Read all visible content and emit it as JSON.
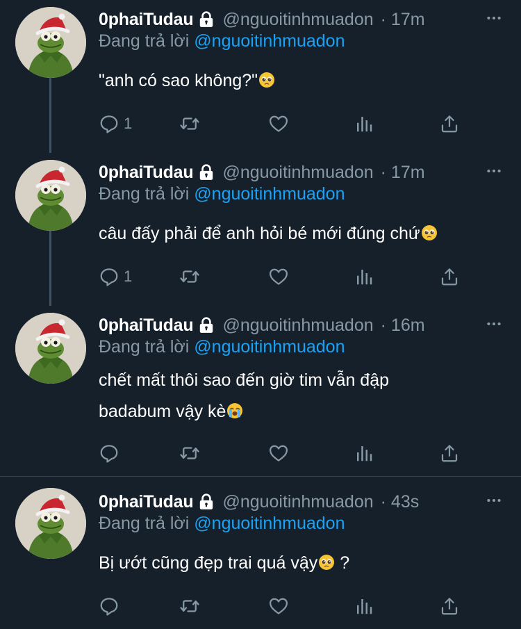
{
  "colors": {
    "background": "#15202b",
    "text": "#ffffff",
    "secondary": "#8899a6",
    "accent": "#1da1f2",
    "divider": "#38444d"
  },
  "tweets": [
    {
      "name": "0phaiTudau",
      "handle": "@nguoitinhmuadon",
      "time": "· 17m",
      "reply_prefix": "Đang trả lời ",
      "reply_to": "@nguoitinhmuadon",
      "lines": [
        "\"anh có sao không?\""
      ],
      "emoji": "pleading-face",
      "trailing_text": "",
      "reply_count": "1",
      "icons": [
        "comment-icon",
        "retweet-icon",
        "like-icon",
        "analytics-icon",
        "share-icon"
      ]
    },
    {
      "name": "0phaiTudau",
      "handle": "@nguoitinhmuadon",
      "time": "· 17m",
      "reply_prefix": "Đang trả lời ",
      "reply_to": "@nguoitinhmuadon",
      "lines": [
        "câu đấy phải để anh hỏi bé mới đúng chứ"
      ],
      "emoji": "pleading-face",
      "trailing_text": "",
      "reply_count": "1",
      "icons": [
        "comment-icon",
        "retweet-icon",
        "like-icon",
        "analytics-icon",
        "share-icon"
      ]
    },
    {
      "name": "0phaiTudau",
      "handle": "@nguoitinhmuadon",
      "time": "· 16m",
      "reply_prefix": "Đang trả lời ",
      "reply_to": "@nguoitinhmuadon",
      "lines": [
        "chết mất thôi sao đến giờ tim vẫn đập",
        "badabum vậy kè"
      ],
      "emoji": "crying-face",
      "trailing_text": "",
      "reply_count": "",
      "icons": [
        "comment-icon",
        "retweet-icon",
        "like-icon",
        "analytics-icon",
        "share-icon"
      ]
    },
    {
      "name": "0phaiTudau",
      "handle": "@nguoitinhmuadon",
      "time": "· 43s",
      "reply_prefix": "Đang trả lời ",
      "reply_to": "@nguoitinhmuadon",
      "lines": [
        "Bị ướt cũng đẹp trai quá vậy"
      ],
      "emoji": "pleading-face",
      "trailing_text": " ?",
      "reply_count": "",
      "icons": [
        "comment-icon",
        "retweet-icon",
        "like-icon",
        "analytics-icon",
        "share-icon"
      ]
    }
  ]
}
